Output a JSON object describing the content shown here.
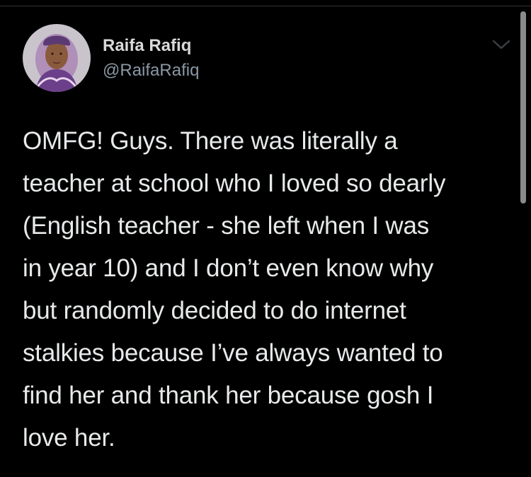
{
  "author": {
    "display_name": "Raifa Rafiq",
    "handle": "@RaifaRafiq",
    "avatar_icon": "profile-photo"
  },
  "menu": {
    "icon": "chevron-down-icon"
  },
  "tweet": {
    "lines": [
      "OMFG! Guys. There was literally a",
      "teacher at school who I loved so dearly",
      "(English teacher - she left when I was",
      "in year 10) and I don’t even know why",
      "but randomly decided to do internet",
      "stalkies because I’ve always wanted to",
      "find her and thank her because gosh I",
      "love her."
    ]
  },
  "colors": {
    "background": "#000000",
    "text": "#e7e9ea",
    "handle": "#8b98a5"
  }
}
